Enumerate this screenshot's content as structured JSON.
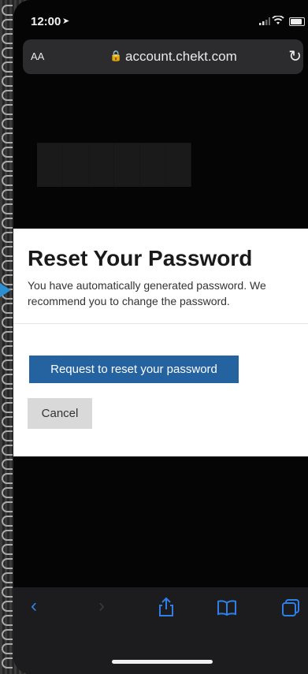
{
  "status_bar": {
    "time": "12:00"
  },
  "browser": {
    "text_size_label": "AA",
    "url": "account.chekt.com"
  },
  "modal": {
    "title": "Reset Your Password",
    "message": "You have automatically generated password. We recommend you to change the password.",
    "primary_button": "Request to reset your password",
    "cancel_button": "Cancel"
  },
  "colors": {
    "primary": "#2563a0",
    "toolbar_accent": "#2f80e6"
  },
  "toolbar_icons": [
    "back-icon",
    "forward-icon",
    "share-icon",
    "bookmarks-icon",
    "tabs-icon"
  ]
}
